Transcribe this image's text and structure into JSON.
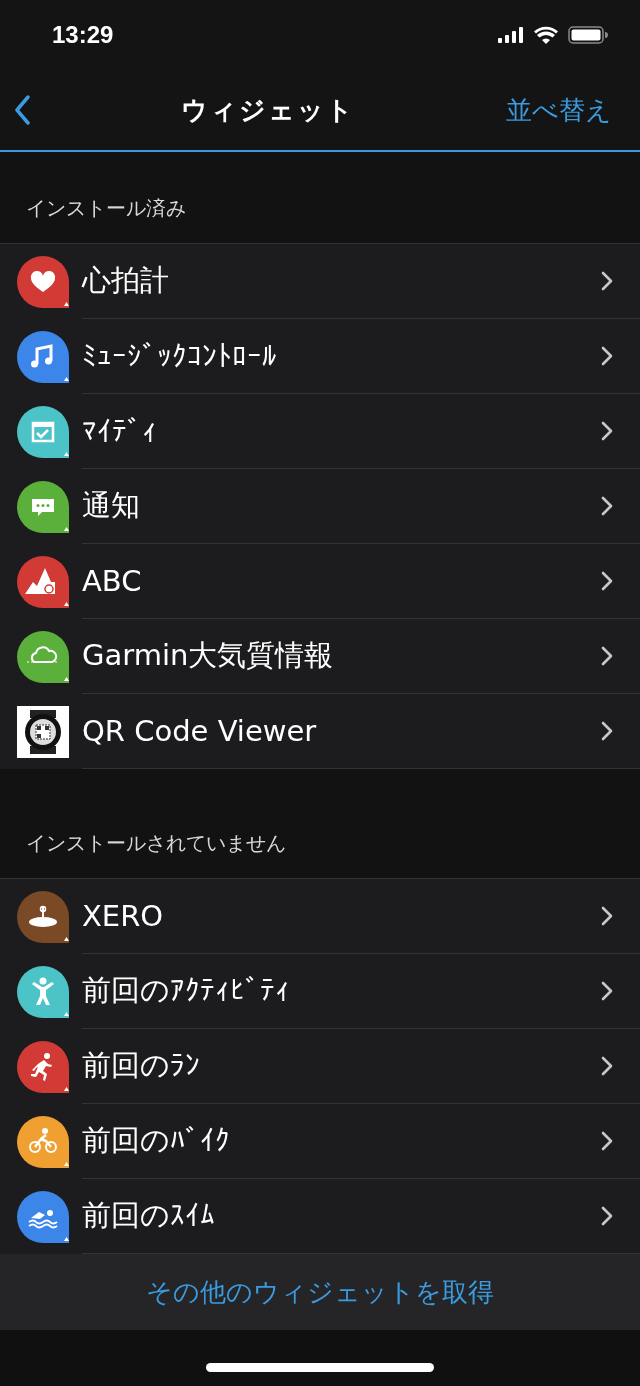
{
  "status_bar": {
    "time": "13:29"
  },
  "nav": {
    "title": "ウィジェット",
    "action": "並べ替え"
  },
  "sections": [
    {
      "title": "インストール済み",
      "items": [
        {
          "label": "心拍計",
          "kind": "heart",
          "color": "#d23a35"
        },
        {
          "label": "ﾐｭｰｼﾞｯｸｺﾝﾄﾛｰﾙ",
          "kind": "music",
          "color": "#3b86e8"
        },
        {
          "label": "ﾏｲﾃﾞｨ",
          "kind": "calendar",
          "color": "#4cc3c6"
        },
        {
          "label": "通知",
          "kind": "chat",
          "color": "#5ab03a"
        },
        {
          "label": "ABC",
          "kind": "mountain",
          "color": "#d23a35"
        },
        {
          "label": "Garmin大気質情報",
          "kind": "cloud",
          "color": "#5ab03a"
        },
        {
          "label": "QR Code Viewer",
          "kind": "watch",
          "color": "#ffffff"
        }
      ]
    },
    {
      "title": "インストールされていません",
      "items": [
        {
          "label": "XERO",
          "kind": "target",
          "color": "#7a4a26"
        },
        {
          "label": "前回のｱｸﾃｨﾋﾞﾃｨ",
          "kind": "person",
          "color": "#4cc3c6"
        },
        {
          "label": "前回のﾗﾝ",
          "kind": "run",
          "color": "#d23a35"
        },
        {
          "label": "前回のﾊﾞｲｸ",
          "kind": "bike",
          "color": "#f0a030"
        },
        {
          "label": "前回のｽｲﾑ",
          "kind": "swim",
          "color": "#3b86e8"
        }
      ]
    }
  ],
  "footer": {
    "link": "その他のウィジェットを取得"
  }
}
